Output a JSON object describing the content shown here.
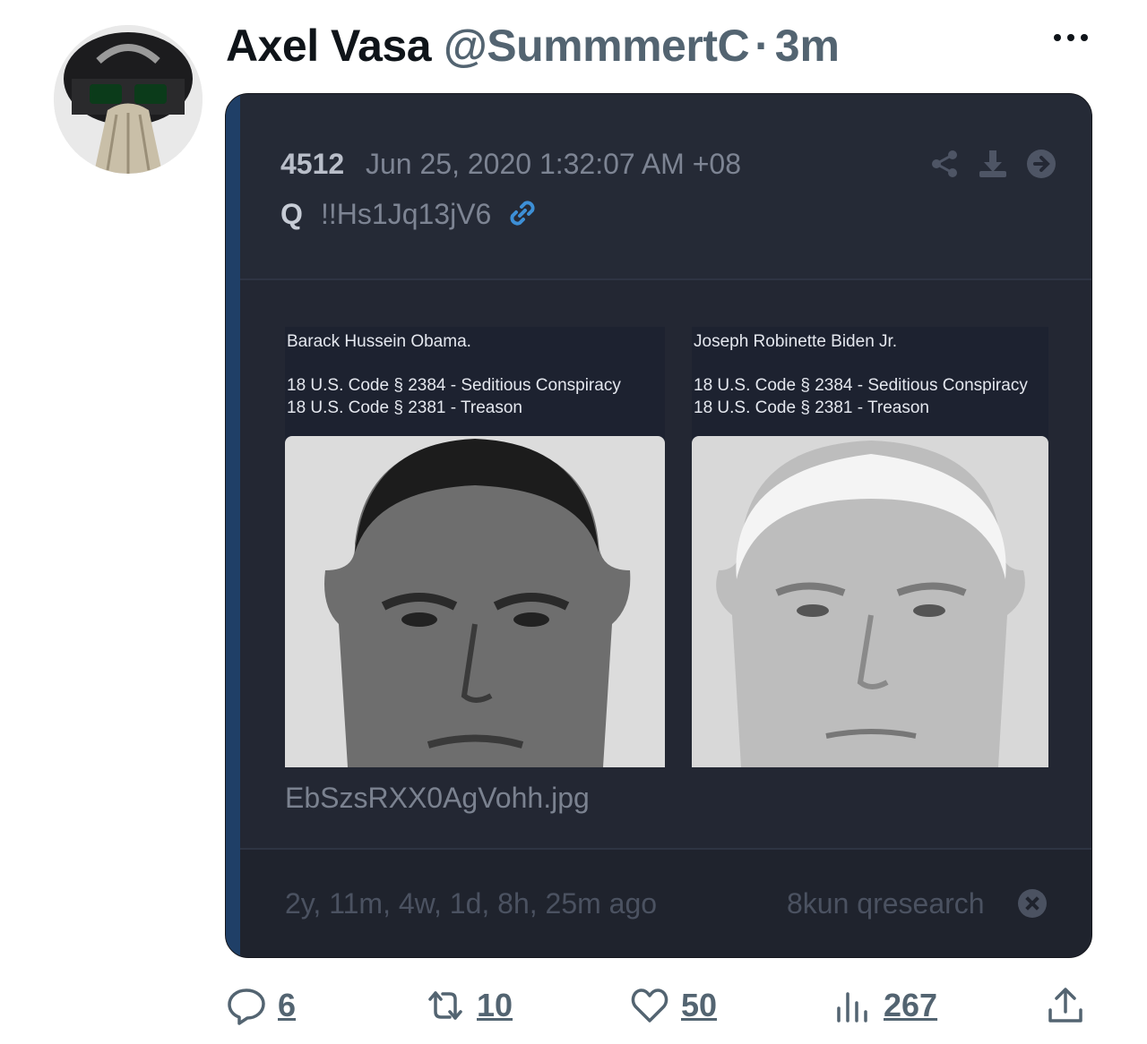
{
  "tweet": {
    "author_name": "Axel Vasa",
    "handle": "@SummmertC",
    "separator": "·",
    "time": "3m",
    "more_icon": "more-horizontal-icon"
  },
  "post": {
    "number": "4512",
    "date": "Jun 25, 2020 1:32:07 AM +08",
    "author": "Q",
    "tripcode": "!!Hs1Jq13jV6",
    "images": [
      {
        "line1": "Barack Hussein Obama.",
        "line2": "18 U.S. Code § 2384 - Seditious Conspiracy",
        "line3": "18 U.S. Code § 2381 - Treason"
      },
      {
        "line1": "Joseph Robinette Biden Jr.",
        "line2": "18 U.S. Code § 2384 - Seditious Conspiracy",
        "line3": "18 U.S. Code § 2381 - Treason"
      }
    ],
    "filename": "EbSzsRXX0AgVohh.jpg",
    "ago": "2y, 11m, 4w, 1d, 8h, 25m ago",
    "source": "8kun qresearch"
  },
  "actions": {
    "replies": "6",
    "retweets": "10",
    "likes": "50",
    "views": "267"
  },
  "colors": {
    "card_bg": "#242834",
    "accent": "#2a5a90",
    "link": "#3d8fd6",
    "muted": "#536471"
  }
}
